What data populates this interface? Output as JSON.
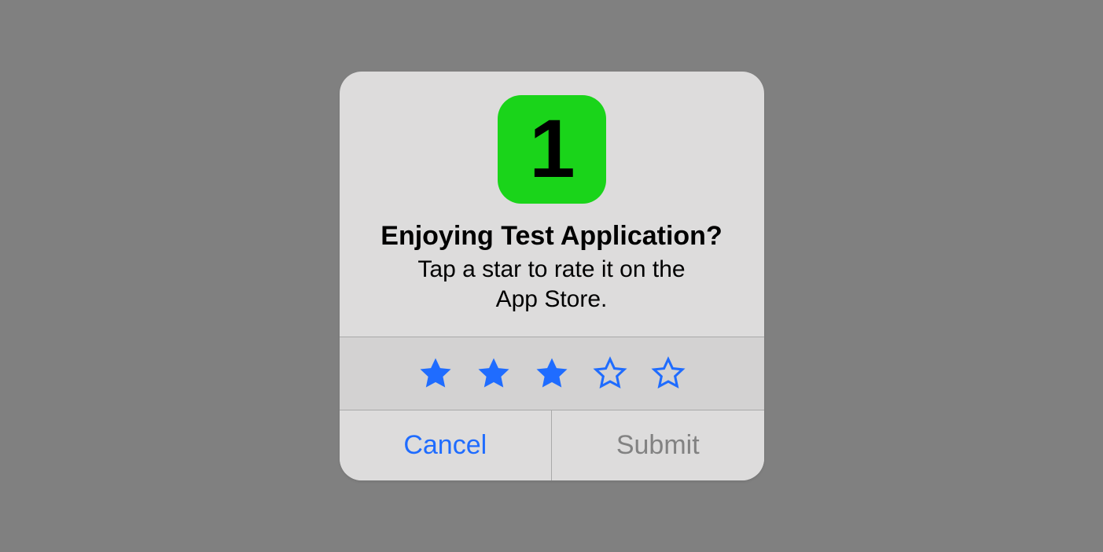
{
  "dialog": {
    "app_icon_text": "1",
    "title": "Enjoying Test Application?",
    "subtitle": "Tap a star to rate it on the App Store.",
    "stars": {
      "count": 5,
      "filled": 3,
      "color": "#1f6cff"
    },
    "buttons": {
      "cancel": "Cancel",
      "submit": "Submit"
    }
  }
}
